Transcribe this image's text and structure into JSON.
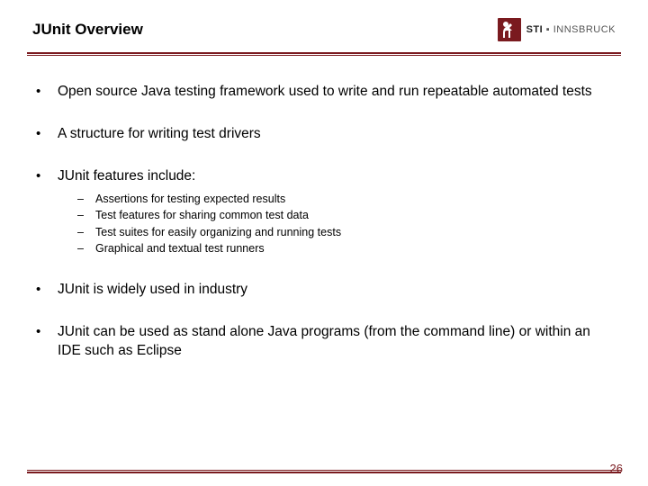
{
  "header": {
    "title": "JUnit Overview",
    "logo": {
      "brand": "STI",
      "sep": " ▪ ",
      "location": "INNSBRUCK"
    }
  },
  "bullets": {
    "b0": "Open source Java testing framework used to write and run repeatable automated tests",
    "b1": "A structure for writing test drivers",
    "b2": "JUnit features include:",
    "b2_sub": {
      "s0": "Assertions for testing expected results",
      "s1": "Test features for sharing common test data",
      "s2": "Test suites for easily organizing and running tests",
      "s3": "Graphical and textual test runners"
    },
    "b3": "JUnit is widely used in industry",
    "b4": "JUnit can be used as stand alone Java programs (from the command line) or within an IDE such as Eclipse"
  },
  "page_number": "26"
}
